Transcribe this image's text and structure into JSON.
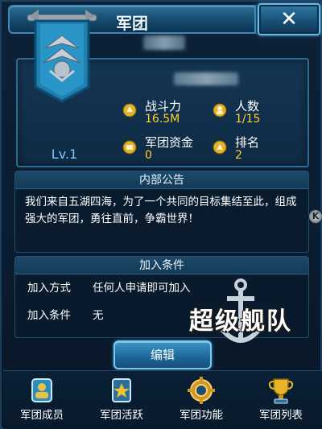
{
  "window": {
    "title": "军团",
    "close_label": "✕"
  },
  "legion": {
    "level": "Lv.1",
    "stats": {
      "power_label": "战斗力",
      "power_value": "16.5M",
      "members_label": "人数",
      "members_value": "1/15",
      "funds_label": "军团资金",
      "funds_value": "0",
      "rank_label": "排名",
      "rank_value": "2"
    }
  },
  "notice": {
    "header": "内部公告",
    "text": "我们来自五湖四海，为了一个共同的目标集结至此，组成强大的军团，勇往直前，争霸世界！"
  },
  "join": {
    "header": "加入条件",
    "method_label": "加入方式",
    "method_value": "任何人申请即可加入",
    "condition_label": "加入条件",
    "condition_value": "无"
  },
  "logo": {
    "text": "超级舰队"
  },
  "side_badge": "K",
  "edit_label": "编辑",
  "bottom_nav": [
    {
      "label": "军团成员",
      "icon": "members-icon"
    },
    {
      "label": "军团活跃",
      "icon": "activity-star-icon"
    },
    {
      "label": "军团功能",
      "icon": "function-gear-icon"
    },
    {
      "label": "军团列表",
      "icon": "trophy-list-icon"
    }
  ],
  "colors": {
    "accent": "#ffd230",
    "level": "#7fc6ff",
    "panel": "#0f2b45"
  }
}
